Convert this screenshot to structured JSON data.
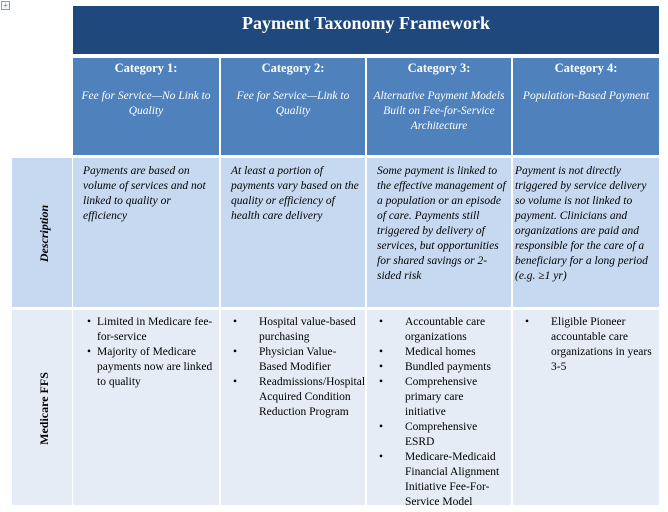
{
  "document": {
    "title": "Payment Taxonomy Framework",
    "columns": [
      {
        "category": "Category 1:",
        "subtitle": "Fee for Service—No Link to Quality"
      },
      {
        "category": "Category 2:",
        "subtitle": "Fee for Service—Link to Quality"
      },
      {
        "category": "Category 3:",
        "subtitle": "Alternative Payment Models Built on Fee-for-Service Architecture"
      },
      {
        "category": "Category 4:",
        "subtitle": "Population-Based Payment"
      }
    ],
    "rows": [
      {
        "label": "Description",
        "cells": [
          "Payments are based on volume of services and not linked to quality or efficiency",
          "At least a portion of payments vary based on the quality or efficiency of health care delivery",
          "Some payment is linked to the effective management of a population or an episode of care. Payments still triggered by delivery of services, but opportunities for shared savings or 2-sided risk",
          "Payment is not directly triggered by service delivery so volume is not linked to payment. Clinicians and organizations are paid and responsible for the care of a beneficiary for a long period (e.g. ≥1 yr)"
        ]
      },
      {
        "label": "Medicare FFS",
        "cells": [
          [
            "Limited in Medicare fee-for-service",
            "Majority of Medicare payments now are linked to quality"
          ],
          [
            "Hospital value-based purchasing",
            "Physician Value-Based Modifier",
            "Readmissions/Hospital Acquired Condition Reduction Program"
          ],
          [
            "Accountable care organizations",
            "Medical homes",
            "Bundled payments",
            "Comprehensive primary care initiative",
            "Comprehensive ESRD",
            "Medicare-Medicaid Financial Alignment Initiative Fee-For-Service Model"
          ],
          [
            "Eligible Pioneer accountable care organizations in years 3-5"
          ]
        ]
      }
    ]
  },
  "icons": {
    "table_move_handle": "move-handle-icon"
  },
  "colors": {
    "title_bg": "#1f497d",
    "header_bg": "#4f81bd",
    "desc_bg": "#c6d9f1",
    "ffs_bg": "#e5ecf5"
  }
}
